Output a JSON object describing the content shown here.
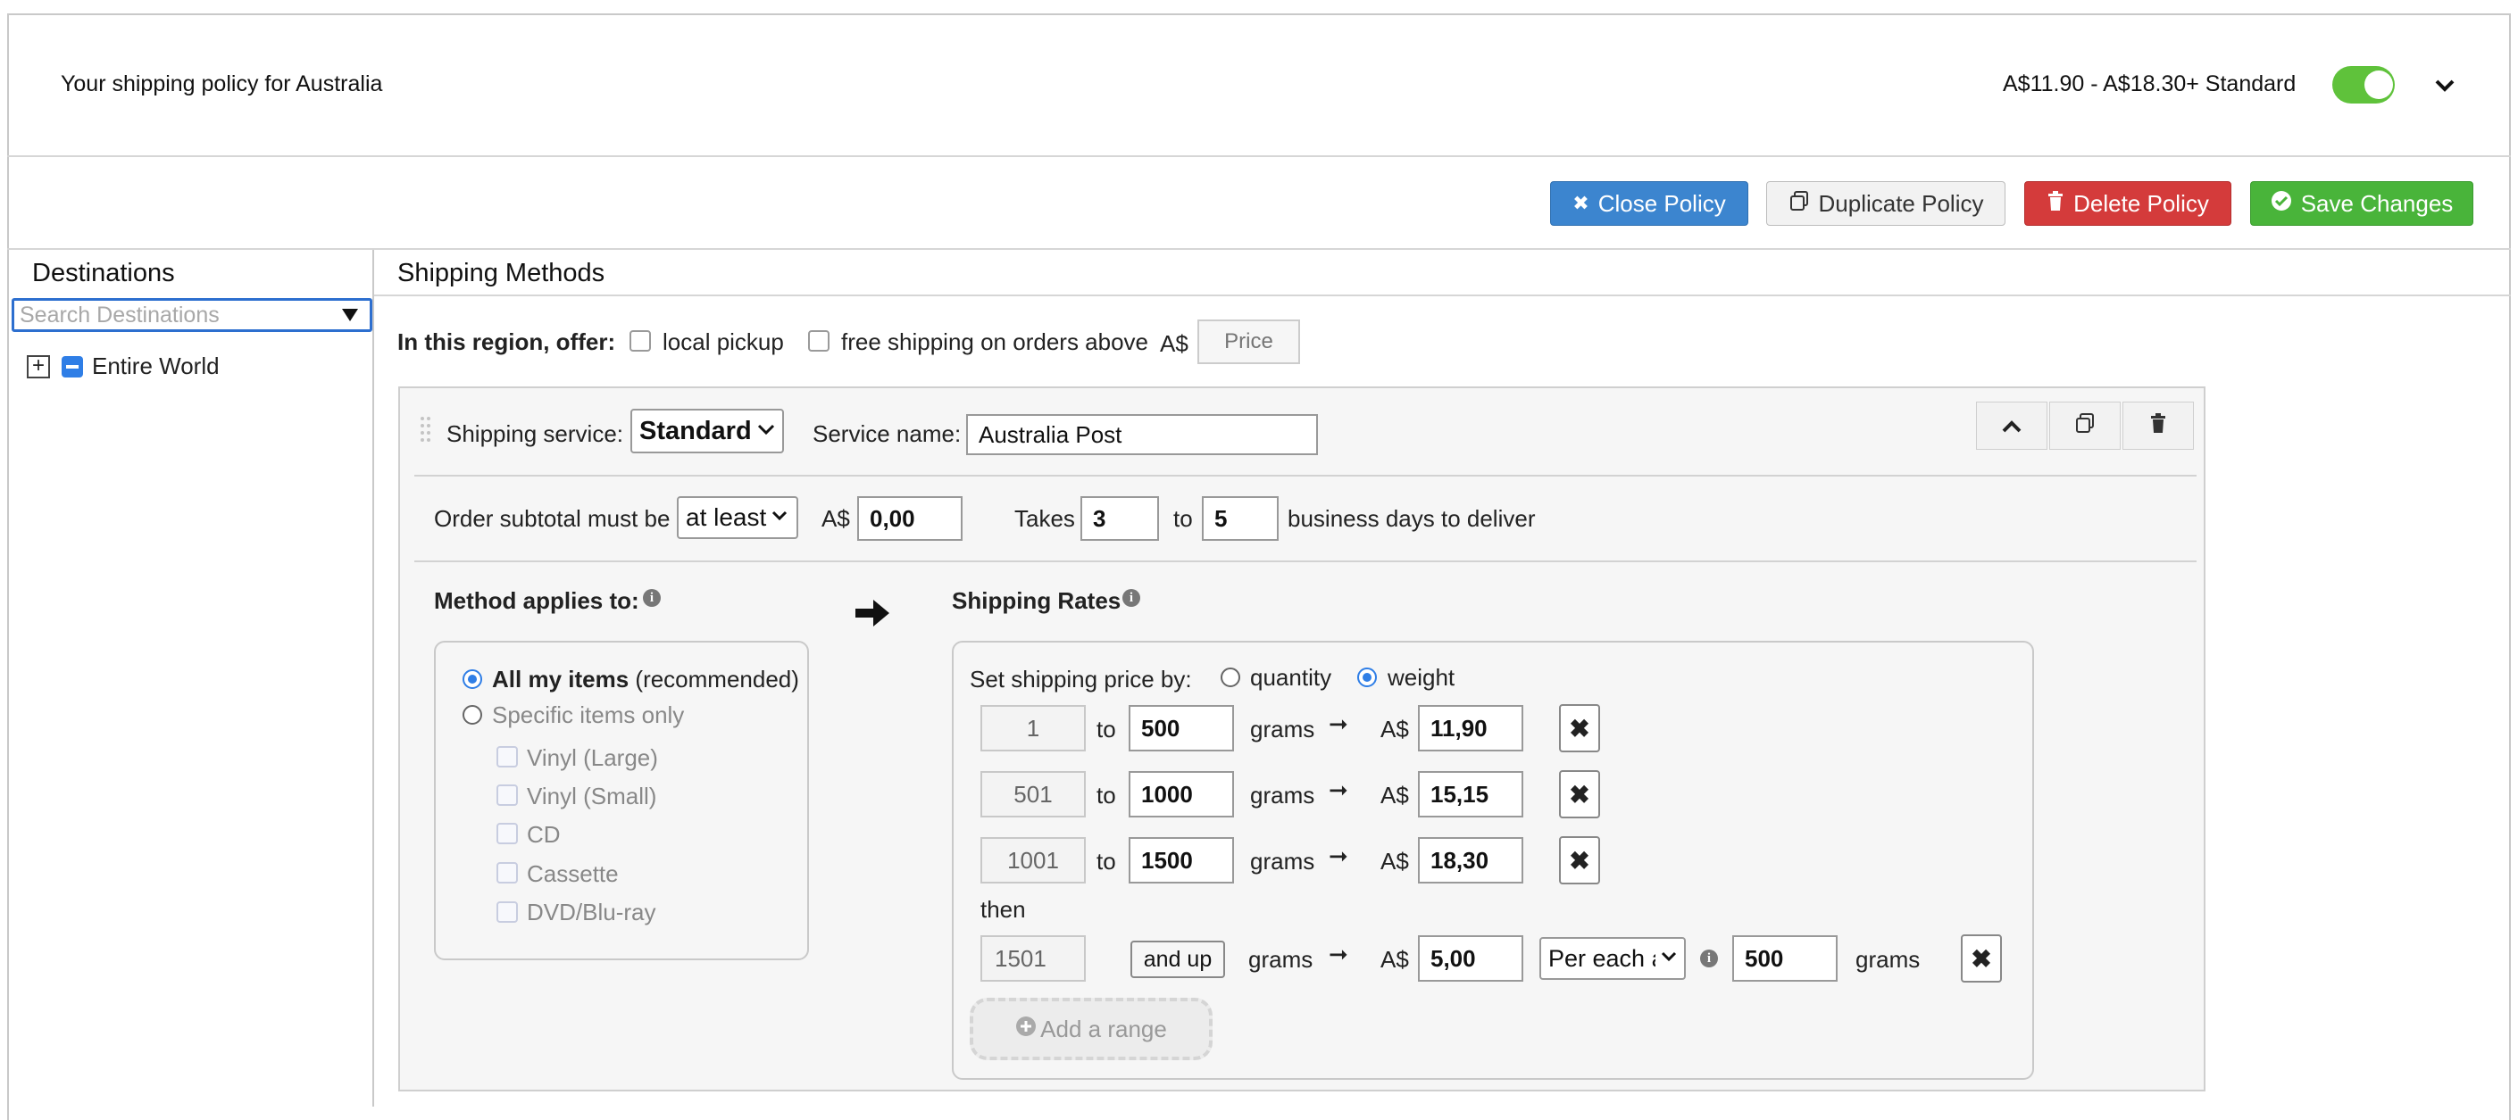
{
  "header": {
    "title": "Your shipping policy for Australia",
    "summary": "A$11.90 - A$18.30+ Standard",
    "toggle_on": true
  },
  "toolbar": {
    "close_label": "Close Policy",
    "duplicate_label": "Duplicate Policy",
    "delete_label": "Delete Policy",
    "save_label": "Save Changes"
  },
  "destinations": {
    "title": "Destinations",
    "search_placeholder": "Search Destinations",
    "tree": [
      {
        "label": "Entire World",
        "expand_symbol": "+"
      }
    ]
  },
  "methods": {
    "title": "Shipping Methods",
    "offer_label": "In this region, offer:",
    "local_pickup": "local pickup",
    "free_shipping": "free shipping on orders above",
    "currency": "A$",
    "price_placeholder": "Price"
  },
  "service": {
    "service_label": "Shipping service:",
    "service_value": "Standard",
    "name_label": "Service name:",
    "name_value": "Australia Post",
    "subtotal_label": "Order subtotal must be",
    "subtotal_op": "at least",
    "subtotal_currency": "A$",
    "subtotal_value": "0,00",
    "takes_label": "Takes",
    "days_min": "3",
    "to_label": "to",
    "days_max": "5",
    "days_suffix": "business days to deliver"
  },
  "applies": {
    "title": "Method applies to:",
    "all_items_bold": "All my items",
    "all_items_rest": "(recommended)",
    "specific_items": "Specific items only",
    "items": [
      "Vinyl (Large)",
      "Vinyl (Small)",
      "CD",
      "Cassette",
      "DVD/Blu-ray"
    ]
  },
  "rates": {
    "title": "Shipping Rates",
    "set_by_label": "Set shipping price by:",
    "opt_quantity": "quantity",
    "opt_weight": "weight",
    "selected": "weight",
    "to_label": "to",
    "unit": "grams",
    "arrow": "➞",
    "currency": "A$",
    "rows": [
      {
        "from": "1",
        "to": "500",
        "price": "11,90"
      },
      {
        "from": "501",
        "to": "1000",
        "price": "15,15"
      },
      {
        "from": "1001",
        "to": "1500",
        "price": "18,30"
      }
    ],
    "then_label": "then",
    "then_row": {
      "from": "1501",
      "and_up": "and up",
      "price": "5,00",
      "per_each": "Per each a",
      "each_value": "500"
    },
    "add_range": "Add a range",
    "remove_symbol": "✖"
  }
}
